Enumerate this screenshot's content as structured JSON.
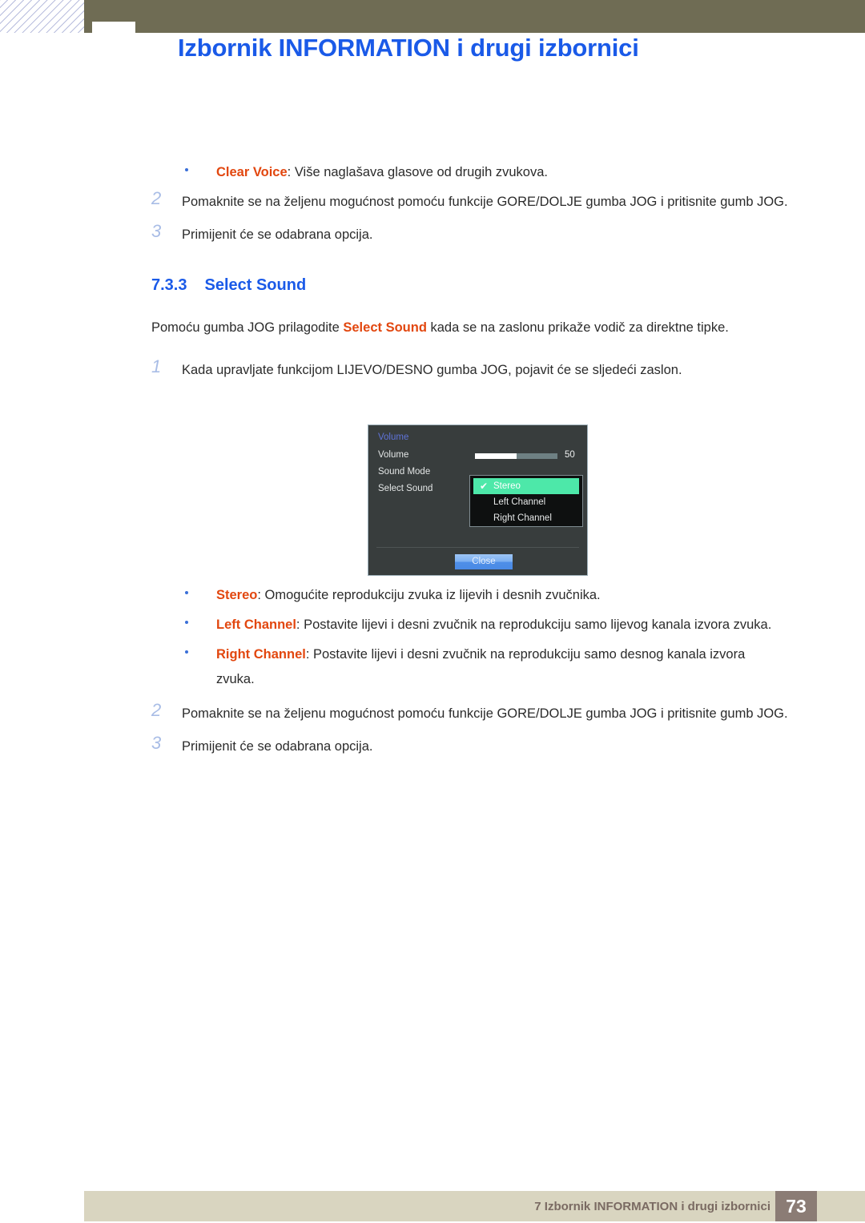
{
  "header": {
    "title": "Izbornik INFORMATION i drugi izbornici"
  },
  "top_section": {
    "bullet": {
      "keyword": "Clear Voice",
      "rest": ": Više naglašava glasove od drugih zvukova."
    },
    "steps": [
      {
        "num": "2",
        "text": "Pomaknite se na željenu mogućnost pomoću funkcije GORE/DOLJE gumba JOG i pritisnite gumb JOG."
      },
      {
        "num": "3",
        "text": "Primijenit će se odabrana opcija."
      }
    ]
  },
  "section": {
    "number": "7.3.3",
    "title": "Select Sound",
    "intro_before": "Pomoću gumba JOG prilagodite ",
    "intro_keyword": "Select Sound",
    "intro_after": " kada se na zaslonu prikaže vodič za direktne tipke.",
    "step1": {
      "num": "1",
      "text": "Kada upravljate funkcijom LIJEVO/DESNO gumba JOG, pojavit će se sljedeći zaslon."
    }
  },
  "osd": {
    "title": "Volume",
    "labels": {
      "volume": "Volume",
      "sound_mode": "Sound Mode",
      "select_sound": "Select Sound"
    },
    "volume_value": "50",
    "volume_percent": 50,
    "submenu": [
      {
        "label": "Stereo",
        "selected": true,
        "check": "✔"
      },
      {
        "label": "Left Channel",
        "selected": false
      },
      {
        "label": "Right Channel",
        "selected": false
      }
    ],
    "close_label": "Close",
    "colors": {
      "panel_bg": "#383d3d",
      "submenu_bg": "#0e1010",
      "highlight": "#4de8a9",
      "title_text": "#5f73d8",
      "close_button": "#7db0f2"
    }
  },
  "options": [
    {
      "keyword": "Stereo",
      "rest": ": Omogućite reprodukciju zvuka iz lijevih i desnih zvučnika."
    },
    {
      "keyword": "Left Channel",
      "rest": ": Postavite lijevi i desni zvučnik na reprodukciju samo lijevog kanala izvora zvuka."
    },
    {
      "keyword": "Right Channel",
      "rest": ": Postavite lijevi i desni zvučnik na reprodukciju samo desnog kanala izvora zvuka."
    }
  ],
  "bottom_steps": [
    {
      "num": "2",
      "text": "Pomaknite se na željenu mogućnost pomoću funkcije GORE/DOLJE gumba JOG i pritisnite gumb JOG."
    },
    {
      "num": "3",
      "text": "Primijenit će se odabrana opcija."
    }
  ],
  "footer": {
    "text": "7 Izbornik INFORMATION i drugi izbornici",
    "page": "73"
  }
}
